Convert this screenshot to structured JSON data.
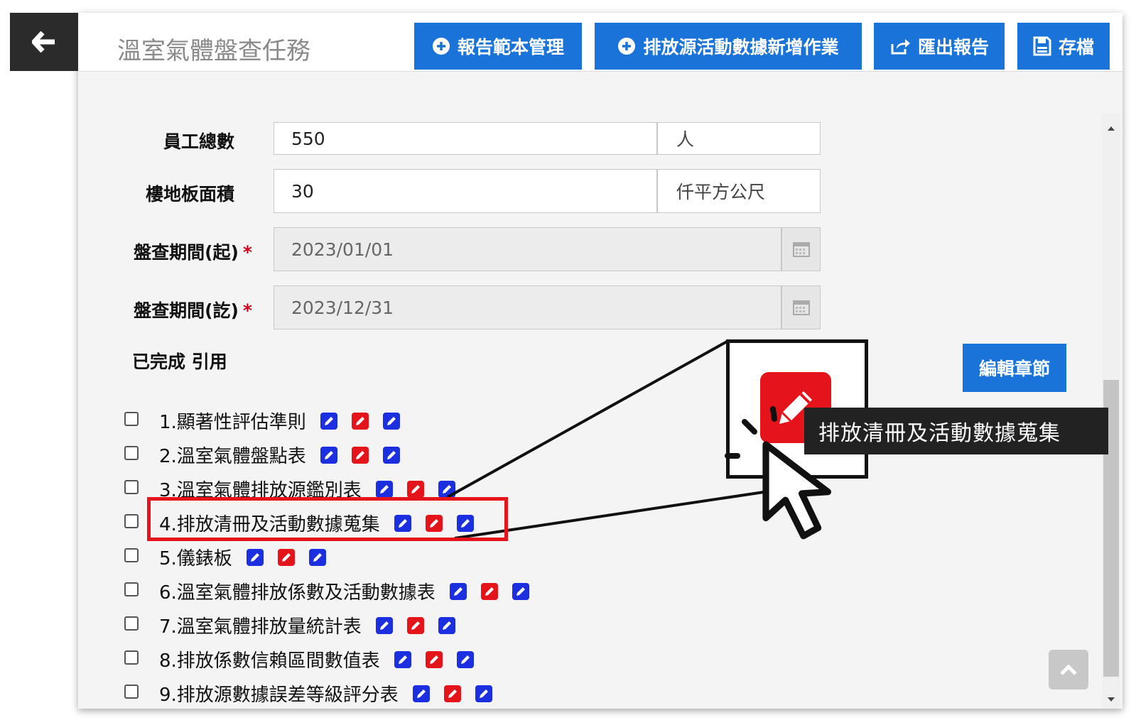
{
  "header": {
    "title": "溫室氣體盤查任務",
    "buttons": {
      "template_mgmt": "報告範本管理",
      "add_activity": "排放源活動數據新增作業",
      "export": "匯出報告",
      "save": "存檔"
    }
  },
  "form": {
    "employees": {
      "label": "員工總數",
      "value": "550",
      "unit": "人"
    },
    "floor_area": {
      "label": "樓地板面積",
      "value": "30",
      "unit": "仟平方公尺"
    },
    "period_start": {
      "label": "盤查期間(起)",
      "required_mark": "*",
      "value": "2023/01/01"
    },
    "period_end": {
      "label": "盤查期間(訖)",
      "required_mark": "*",
      "value": "2023/12/31"
    }
  },
  "section_header": "已完成 引用",
  "edit_section_button": "編輯章節",
  "chapters": [
    {
      "label": "1.顯著性評估準則"
    },
    {
      "label": "2.溫室氣體盤點表"
    },
    {
      "label": "3.溫室氣體排放源鑑別表"
    },
    {
      "label": "4.排放清冊及活動數據蒐集"
    },
    {
      "label": "5.儀錶板"
    },
    {
      "label": "6.溫室氣體排放係數及活動數據表"
    },
    {
      "label": "7.溫室氣體排放量統計表"
    },
    {
      "label": "8.排放係數信賴區間數值表"
    },
    {
      "label": "9.排放源數據誤差等級評分表"
    }
  ],
  "tooltip": "排放清冊及活動數據蒐集",
  "colors": {
    "primary_button": "#1a73d9",
    "edit_blue": "#1b2fe0",
    "edit_red": "#e5141b",
    "highlight": "#e5141b"
  }
}
